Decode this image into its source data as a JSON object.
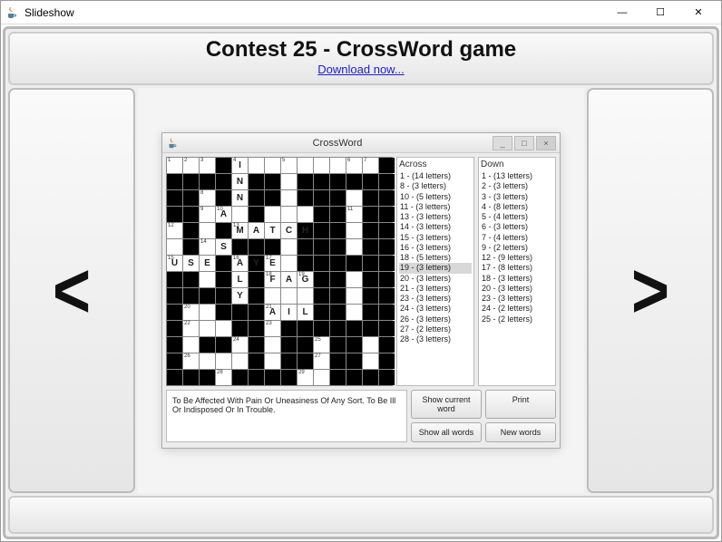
{
  "window": {
    "title": "Slideshow"
  },
  "header": {
    "title": "Contest 25 - CrossWord game",
    "link_text": "Download now..."
  },
  "nav": {
    "prev": "<",
    "next": ">"
  },
  "inner": {
    "title": "CrossWord",
    "clue_text": "To Be Affected With Pain Or Uneasiness Of Any Sort. To Be Ill Or Indisposed Or In Trouble.",
    "buttons": {
      "show_current": "Show current word",
      "print": "Print",
      "show_all": "Show all words",
      "new_words": "New words"
    },
    "across": {
      "header": "Across",
      "items": [
        {
          "n": 1,
          "len": 14
        },
        {
          "n": 8,
          "len": 3
        },
        {
          "n": 10,
          "len": 5
        },
        {
          "n": 11,
          "len": 3
        },
        {
          "n": 13,
          "len": 3
        },
        {
          "n": 14,
          "len": 3
        },
        {
          "n": 15,
          "len": 3
        },
        {
          "n": 16,
          "len": 3
        },
        {
          "n": 18,
          "len": 5
        },
        {
          "n": 19,
          "len": 3
        },
        {
          "n": 20,
          "len": 3
        },
        {
          "n": 21,
          "len": 3
        },
        {
          "n": 23,
          "len": 3
        },
        {
          "n": 24,
          "len": 3
        },
        {
          "n": 26,
          "len": 3
        },
        {
          "n": 27,
          "len": 2
        },
        {
          "n": 28,
          "len": 3
        }
      ],
      "selected_index": 9
    },
    "down": {
      "header": "Down",
      "items": [
        {
          "n": 1,
          "len": 13
        },
        {
          "n": 2,
          "len": 3
        },
        {
          "n": 3,
          "len": 3
        },
        {
          "n": 4,
          "len": 8
        },
        {
          "n": 5,
          "len": 4
        },
        {
          "n": 6,
          "len": 3
        },
        {
          "n": 7,
          "len": 4
        },
        {
          "n": 9,
          "len": 2
        },
        {
          "n": 12,
          "len": 9
        },
        {
          "n": 17,
          "len": 8
        },
        {
          "n": 18,
          "len": 3
        },
        {
          "n": 20,
          "len": 3
        },
        {
          "n": 23,
          "len": 3
        },
        {
          "n": 24,
          "len": 2
        },
        {
          "n": 25,
          "len": 2
        }
      ]
    }
  },
  "grid": {
    "cols": 14,
    "rows": 14,
    "black": [
      [
        0,
        3
      ],
      [
        0,
        13
      ],
      [
        1,
        0
      ],
      [
        1,
        1
      ],
      [
        1,
        2
      ],
      [
        1,
        3
      ],
      [
        1,
        5
      ],
      [
        1,
        6
      ],
      [
        1,
        8
      ],
      [
        1,
        9
      ],
      [
        1,
        10
      ],
      [
        1,
        11
      ],
      [
        1,
        12
      ],
      [
        1,
        13
      ],
      [
        2,
        0
      ],
      [
        2,
        1
      ],
      [
        2,
        3
      ],
      [
        2,
        5
      ],
      [
        2,
        6
      ],
      [
        2,
        8
      ],
      [
        2,
        9
      ],
      [
        2,
        10
      ],
      [
        2,
        12
      ],
      [
        2,
        13
      ],
      [
        3,
        0
      ],
      [
        3,
        1
      ],
      [
        3,
        5
      ],
      [
        3,
        9
      ],
      [
        3,
        10
      ],
      [
        3,
        12
      ],
      [
        3,
        13
      ],
      [
        4,
        1
      ],
      [
        4,
        3
      ],
      [
        4,
        8
      ],
      [
        4,
        9
      ],
      [
        4,
        10
      ],
      [
        4,
        12
      ],
      [
        4,
        13
      ],
      [
        5,
        1
      ],
      [
        5,
        4
      ],
      [
        5,
        5
      ],
      [
        5,
        6
      ],
      [
        5,
        8
      ],
      [
        5,
        9
      ],
      [
        5,
        10
      ],
      [
        5,
        12
      ],
      [
        5,
        13
      ],
      [
        6,
        3
      ],
      [
        6,
        5
      ],
      [
        6,
        8
      ],
      [
        6,
        9
      ],
      [
        6,
        10
      ],
      [
        6,
        11
      ],
      [
        6,
        12
      ],
      [
        6,
        13
      ],
      [
        7,
        0
      ],
      [
        7,
        1
      ],
      [
        7,
        3
      ],
      [
        7,
        5
      ],
      [
        7,
        9
      ],
      [
        7,
        10
      ],
      [
        7,
        12
      ],
      [
        7,
        13
      ],
      [
        8,
        0
      ],
      [
        8,
        1
      ],
      [
        8,
        2
      ],
      [
        8,
        3
      ],
      [
        8,
        5
      ],
      [
        8,
        9
      ],
      [
        8,
        10
      ],
      [
        8,
        12
      ],
      [
        8,
        13
      ],
      [
        9,
        0
      ],
      [
        9,
        3
      ],
      [
        9,
        4
      ],
      [
        9,
        5
      ],
      [
        9,
        9
      ],
      [
        9,
        10
      ],
      [
        9,
        12
      ],
      [
        9,
        13
      ],
      [
        10,
        0
      ],
      [
        10,
        4
      ],
      [
        10,
        5
      ],
      [
        10,
        7
      ],
      [
        10,
        8
      ],
      [
        10,
        9
      ],
      [
        10,
        10
      ],
      [
        10,
        11
      ],
      [
        10,
        12
      ],
      [
        10,
        13
      ],
      [
        11,
        0
      ],
      [
        11,
        2
      ],
      [
        11,
        3
      ],
      [
        11,
        5
      ],
      [
        11,
        7
      ],
      [
        11,
        8
      ],
      [
        11,
        10
      ],
      [
        11,
        11
      ],
      [
        11,
        13
      ],
      [
        12,
        0
      ],
      [
        12,
        5
      ],
      [
        12,
        7
      ],
      [
        12,
        8
      ],
      [
        12,
        10
      ],
      [
        12,
        11
      ],
      [
        12,
        13
      ],
      [
        13,
        0
      ],
      [
        13,
        1
      ],
      [
        13,
        2
      ],
      [
        13,
        4
      ],
      [
        13,
        5
      ],
      [
        13,
        6
      ],
      [
        13,
        7
      ],
      [
        13,
        10
      ],
      [
        13,
        11
      ],
      [
        13,
        12
      ],
      [
        13,
        13
      ]
    ],
    "numbers": [
      {
        "r": 0,
        "c": 0,
        "n": 1
      },
      {
        "r": 0,
        "c": 1,
        "n": 2
      },
      {
        "r": 0,
        "c": 2,
        "n": 3
      },
      {
        "r": 0,
        "c": 4,
        "n": 4
      },
      {
        "r": 0,
        "c": 7,
        "n": 5
      },
      {
        "r": 0,
        "c": 11,
        "n": 6
      },
      {
        "r": 0,
        "c": 12,
        "n": 7
      },
      {
        "r": 2,
        "c": 2,
        "n": 8
      },
      {
        "r": 3,
        "c": 2,
        "n": 9
      },
      {
        "r": 3,
        "c": 3,
        "n": 10
      },
      {
        "r": 3,
        "c": 11,
        "n": 11
      },
      {
        "r": 4,
        "c": 0,
        "n": 12
      },
      {
        "r": 4,
        "c": 4,
        "n": 13
      },
      {
        "r": 5,
        "c": 2,
        "n": 14
      },
      {
        "r": 6,
        "c": 0,
        "n": 15
      },
      {
        "r": 6,
        "c": 4,
        "n": 16
      },
      {
        "r": 6,
        "c": 6,
        "n": 17
      },
      {
        "r": 7,
        "c": 6,
        "n": 18
      },
      {
        "r": 7,
        "c": 8,
        "n": 19
      },
      {
        "r": 9,
        "c": 1,
        "n": 20
      },
      {
        "r": 9,
        "c": 6,
        "n": 21
      },
      {
        "r": 10,
        "c": 1,
        "n": 22
      },
      {
        "r": 10,
        "c": 6,
        "n": 23
      },
      {
        "r": 11,
        "c": 4,
        "n": 24
      },
      {
        "r": 11,
        "c": 9,
        "n": 25
      },
      {
        "r": 12,
        "c": 1,
        "n": 26
      },
      {
        "r": 12,
        "c": 9,
        "n": 27
      },
      {
        "r": 13,
        "c": 3,
        "n": 28
      },
      {
        "r": 13,
        "c": 8,
        "n": 29
      }
    ],
    "letters": [
      {
        "r": 0,
        "c": 4,
        "l": "I"
      },
      {
        "r": 1,
        "c": 4,
        "l": "N"
      },
      {
        "r": 2,
        "c": 4,
        "l": "N"
      },
      {
        "r": 3,
        "c": 3,
        "l": "A"
      },
      {
        "r": 4,
        "c": 4,
        "l": "M"
      },
      {
        "r": 4,
        "c": 5,
        "l": "A"
      },
      {
        "r": 4,
        "c": 6,
        "l": "T"
      },
      {
        "r": 4,
        "c": 7,
        "l": "C"
      },
      {
        "r": 4,
        "c": 8,
        "l": "H"
      },
      {
        "r": 5,
        "c": 3,
        "l": "S"
      },
      {
        "r": 6,
        "c": 0,
        "l": "U"
      },
      {
        "r": 6,
        "c": 1,
        "l": "S"
      },
      {
        "r": 6,
        "c": 2,
        "l": "E"
      },
      {
        "r": 6,
        "c": 4,
        "l": "A"
      },
      {
        "r": 6,
        "c": 5,
        "l": "Y"
      },
      {
        "r": 6,
        "c": 6,
        "l": "E"
      },
      {
        "r": 7,
        "c": 4,
        "l": "L"
      },
      {
        "r": 7,
        "c": 6,
        "l": "F"
      },
      {
        "r": 7,
        "c": 7,
        "l": "A"
      },
      {
        "r": 7,
        "c": 8,
        "l": "G"
      },
      {
        "r": 8,
        "c": 4,
        "l": "Y"
      },
      {
        "r": 9,
        "c": 6,
        "l": "A"
      },
      {
        "r": 9,
        "c": 7,
        "l": "I"
      },
      {
        "r": 9,
        "c": 8,
        "l": "L"
      }
    ]
  }
}
